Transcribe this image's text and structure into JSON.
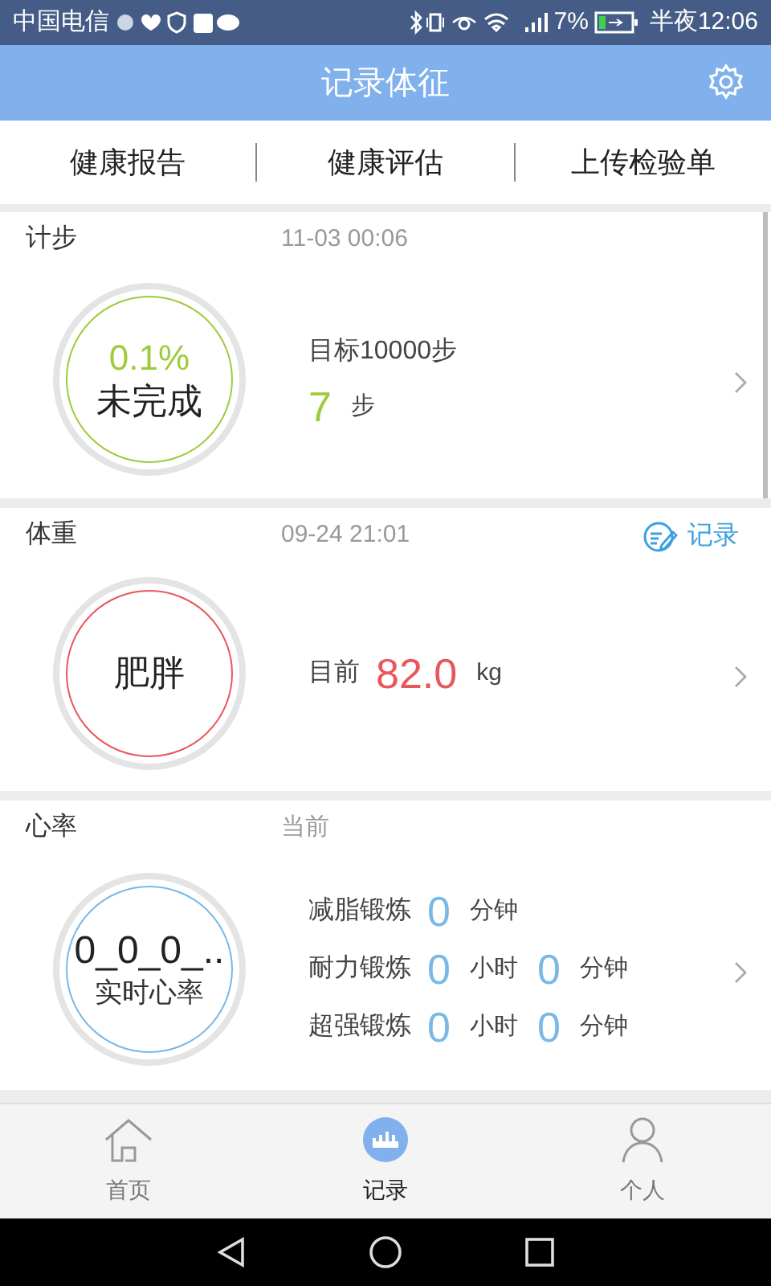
{
  "status_bar": {
    "carrier": "中国电信",
    "battery": "7%",
    "time": "半夜12:06"
  },
  "header": {
    "title": "记录体征"
  },
  "tabs": [
    {
      "label": "健康报告"
    },
    {
      "label": "健康评估"
    },
    {
      "label": "上传检验单"
    }
  ],
  "cards": [
    {
      "kind": "steps",
      "title": "计步",
      "time": "11-03 00:06",
      "circle": {
        "value": "0.1%",
        "label": "未完成",
        "color": "#9ccc3c"
      },
      "rows": [
        [
          {
            "kind": "label",
            "text": "目标10000步"
          }
        ],
        [
          {
            "kind": "number",
            "text": "7"
          },
          {
            "kind": "unit",
            "text": "步"
          }
        ]
      ]
    },
    {
      "kind": "weight",
      "title": "体重",
      "time": "09-24 21:01",
      "action": "记录",
      "circle": {
        "label": "肥胖",
        "color": "#e8575a"
      },
      "rows": [
        [
          {
            "kind": "label",
            "text": "目前"
          },
          {
            "kind": "number",
            "text": "82.0"
          },
          {
            "kind": "unit",
            "text": "kg"
          }
        ]
      ]
    },
    {
      "kind": "heart",
      "title": "心率",
      "time": "当前",
      "circle": {
        "value": "0_0_0_..",
        "label": "实时心率",
        "color": "#7ab8e6"
      },
      "rows": [
        [
          {
            "kind": "label",
            "text": "减脂锻炼"
          },
          {
            "kind": "number",
            "text": "0"
          },
          {
            "kind": "unit",
            "text": "分钟"
          }
        ],
        [
          {
            "kind": "label",
            "text": "耐力锻炼"
          },
          {
            "kind": "number",
            "text": "0"
          },
          {
            "kind": "unit",
            "text": "小时"
          },
          {
            "kind": "number",
            "text": "0"
          },
          {
            "kind": "unit",
            "text": "分钟"
          }
        ],
        [
          {
            "kind": "label",
            "text": "超强锻炼"
          },
          {
            "kind": "number",
            "text": "0"
          },
          {
            "kind": "unit",
            "text": "小时"
          },
          {
            "kind": "number",
            "text": "0"
          },
          {
            "kind": "unit",
            "text": "分钟"
          }
        ]
      ]
    }
  ],
  "bottom_nav": [
    {
      "label": "首页",
      "selected": false
    },
    {
      "label": "记录",
      "selected": true
    },
    {
      "label": "个人",
      "selected": false
    }
  ]
}
